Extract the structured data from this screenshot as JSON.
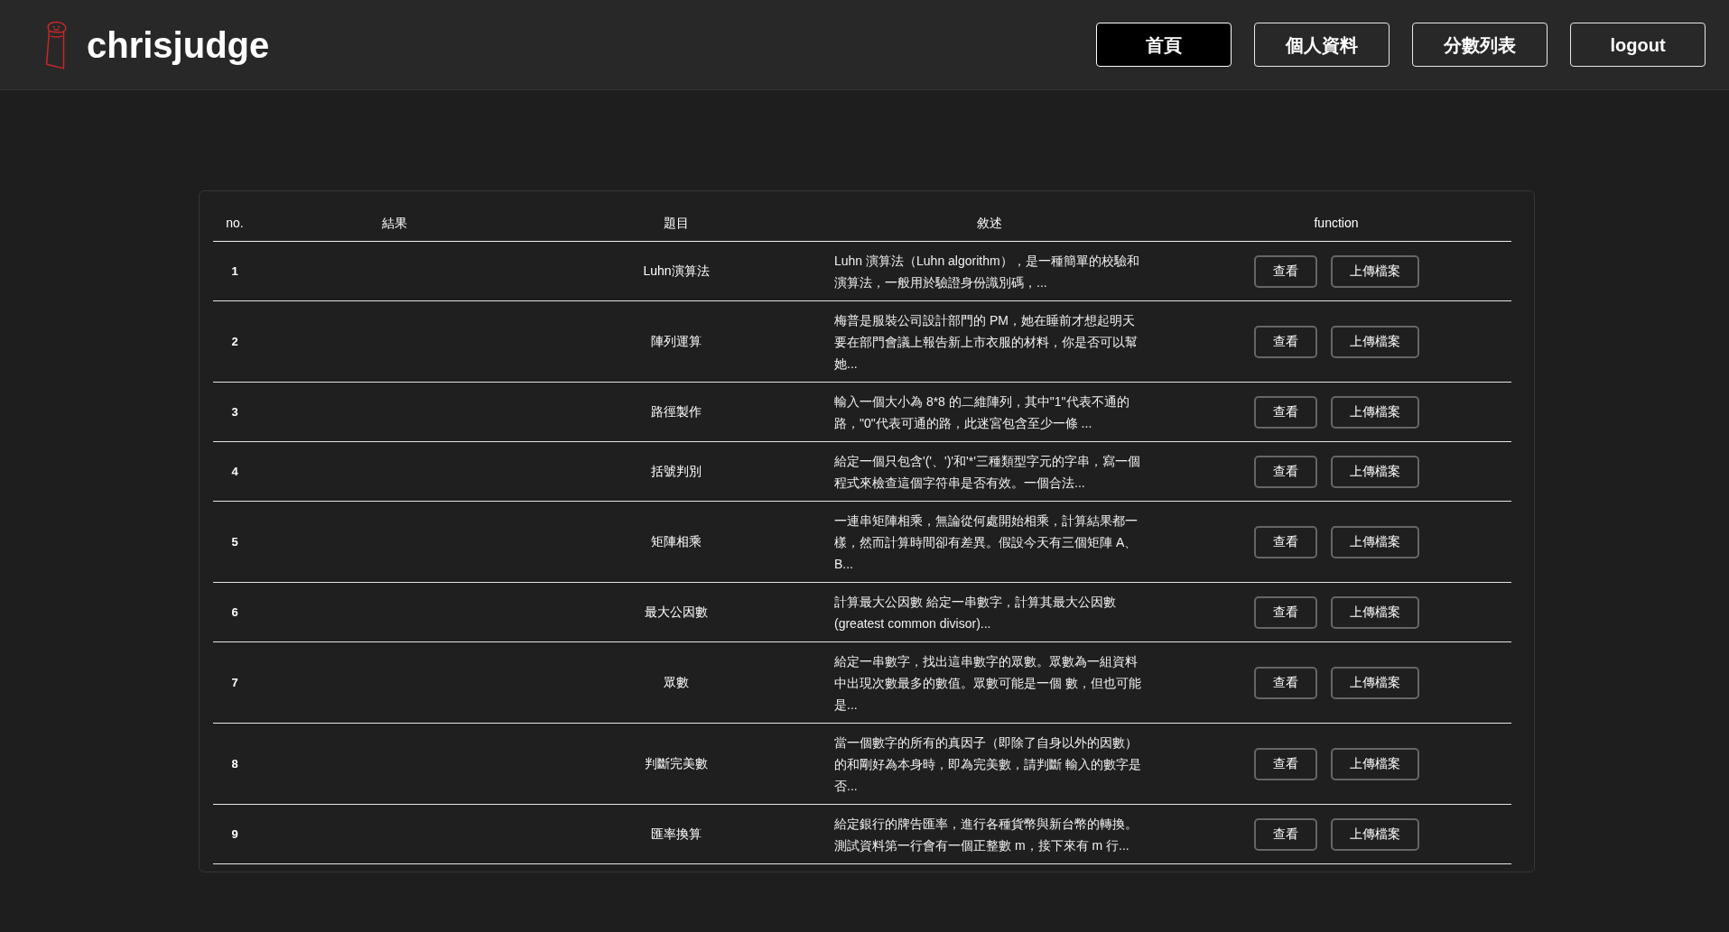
{
  "header": {
    "brand": "chrisjudge",
    "nav": [
      {
        "label": "首頁",
        "selected": true
      },
      {
        "label": "個人資料",
        "selected": false
      },
      {
        "label": "分數列表",
        "selected": false
      },
      {
        "label": "logout",
        "selected": false
      }
    ]
  },
  "table": {
    "columns": [
      "no.",
      "結果",
      "題目",
      "敘述",
      "function"
    ],
    "rows": [
      {
        "no": "1",
        "title": "Luhn演算法",
        "description": "Luhn 演算法（Luhn algorithm），是一種簡單的校驗和演算法，一般用於驗證身份識別碼，...",
        "actions": [
          "查看",
          "上傳檔案"
        ]
      },
      {
        "no": "2",
        "title": "陣列運算",
        "description": "梅普是服裝公司設計部門的 PM，她在睡前才想起明天要在部門會議上報告新上市衣服的材料，你是否可以幫她...",
        "actions": [
          "查看",
          "上傳檔案"
        ]
      },
      {
        "no": "3",
        "title": "路徑製作",
        "description": "輸入一個大小為 8*8 的二維陣列，其中\"1\"代表不通的路，\"0\"代表可通的路，此迷宮包含至少一條 ...",
        "actions": [
          "查看",
          "上傳檔案"
        ]
      },
      {
        "no": "4",
        "title": "括號判別",
        "description": "給定一個只包含'('、')'和'*'三種類型字元的字串，寫一個程式來檢查這個字符串是否有效。一個合法...",
        "actions": [
          "查看",
          "上傳檔案"
        ]
      },
      {
        "no": "5",
        "title": "矩陣相乘",
        "description": "一連串矩陣相乘，無論從何處開始相乘，計算結果都一樣，然而計算時間卻有差異。假設今天有三個矩陣 A、B...",
        "actions": [
          "查看",
          "上傳檔案"
        ]
      },
      {
        "no": "6",
        "title": "最大公因數",
        "description": "計算最大公因數 給定一串數字，計算其最大公因數(greatest common divisor)...",
        "actions": [
          "查看",
          "上傳檔案"
        ]
      },
      {
        "no": "7",
        "title": "眾數",
        "description": "給定一串數字，找出這串數字的眾數。眾數為一組資料中出現次數最多的數值。眾數可能是一個 數，但也可能是...",
        "actions": [
          "查看",
          "上傳檔案"
        ]
      },
      {
        "no": "8",
        "title": "判斷完美數",
        "description": "當一個數字的所有的真因子（即除了自身以外的因數）的和剛好為本身時，即為完美數，請判斷 輸入的數字是否...",
        "actions": [
          "查看",
          "上傳檔案"
        ]
      },
      {
        "no": "9",
        "title": "匯率換算",
        "description": "給定銀行的牌告匯率，進行各種貨幣與新台幣的轉換。測試資料第一行會有一個正整數 m，接下來有 m 行...",
        "actions": [
          "查看",
          "上傳檔案"
        ]
      }
    ]
  }
}
